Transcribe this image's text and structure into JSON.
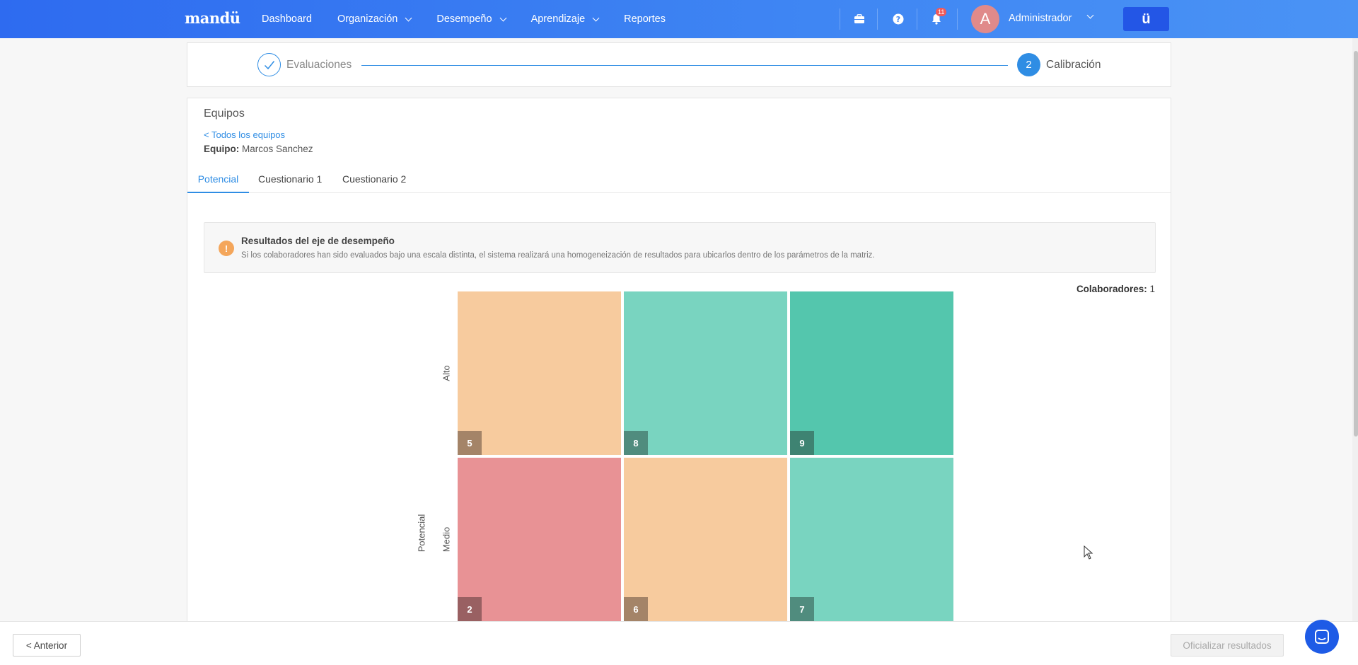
{
  "topnav": {
    "logo": "mandü",
    "items": [
      {
        "label": "Dashboard",
        "has_dropdown": false
      },
      {
        "label": "Organización",
        "has_dropdown": true
      },
      {
        "label": "Desempeño",
        "has_dropdown": true
      },
      {
        "label": "Aprendizaje",
        "has_dropdown": true
      },
      {
        "label": "Reportes",
        "has_dropdown": false
      }
    ],
    "icons": [
      "briefcase-icon",
      "help-icon",
      "bell-icon"
    ],
    "notification_count": "11",
    "avatar_initial": "A",
    "user_name": "Administrador",
    "brand_button": "ü",
    "colors": {
      "nav_start": "#2e6bf0",
      "nav_end": "#4a93f5",
      "brand_button": "#2356e6"
    }
  },
  "stepper": {
    "steps": [
      {
        "label": "Evaluaciones",
        "state": "completed"
      },
      {
        "number": "2",
        "label": "Calibración",
        "state": "active"
      }
    ],
    "accent": "#2f8de4"
  },
  "card": {
    "title": "Equipos",
    "back_link": "< Todos los equipos",
    "team_label": "Equipo:",
    "team_value": "Marcos Sanchez",
    "tabs": [
      {
        "label": "Potencial",
        "active": true
      },
      {
        "label": "Cuestionario 1",
        "active": false
      },
      {
        "label": "Cuestionario 2",
        "active": false
      }
    ],
    "alert": {
      "icon": "!",
      "title": "Resultados del eje de desempeño",
      "text": "Si los colaboradores han sido evaluados bajo una escala distinta, el sistema realizará una homogeneización de resultados para ubicarlos dentro de los parámetros de la matriz."
    },
    "collaborators_label": "Colaboradores:",
    "collaborators_value": "1"
  },
  "matrix": {
    "y_axis_title": "Potencial",
    "rows": [
      {
        "label": "Alto",
        "cells": [
          {
            "number": "5",
            "color": "#f7cb9e",
            "tag": "#a48468"
          },
          {
            "number": "8",
            "color": "#79d4c0",
            "tag": "#508c7e"
          },
          {
            "number": "9",
            "color": "#54c6ad",
            "tag": "#3e8372"
          }
        ]
      },
      {
        "label": "Medio",
        "cells": [
          {
            "number": "2",
            "color": "#e89295",
            "tag": "#996062"
          },
          {
            "number": "6",
            "color": "#f7cb9e",
            "tag": "#a48468"
          },
          {
            "number": "7",
            "color": "#79d4c0",
            "tag": "#508c7e"
          }
        ]
      }
    ]
  },
  "footer": {
    "prev_label": "< Anterior",
    "official_label": "Oficializar resultados"
  }
}
